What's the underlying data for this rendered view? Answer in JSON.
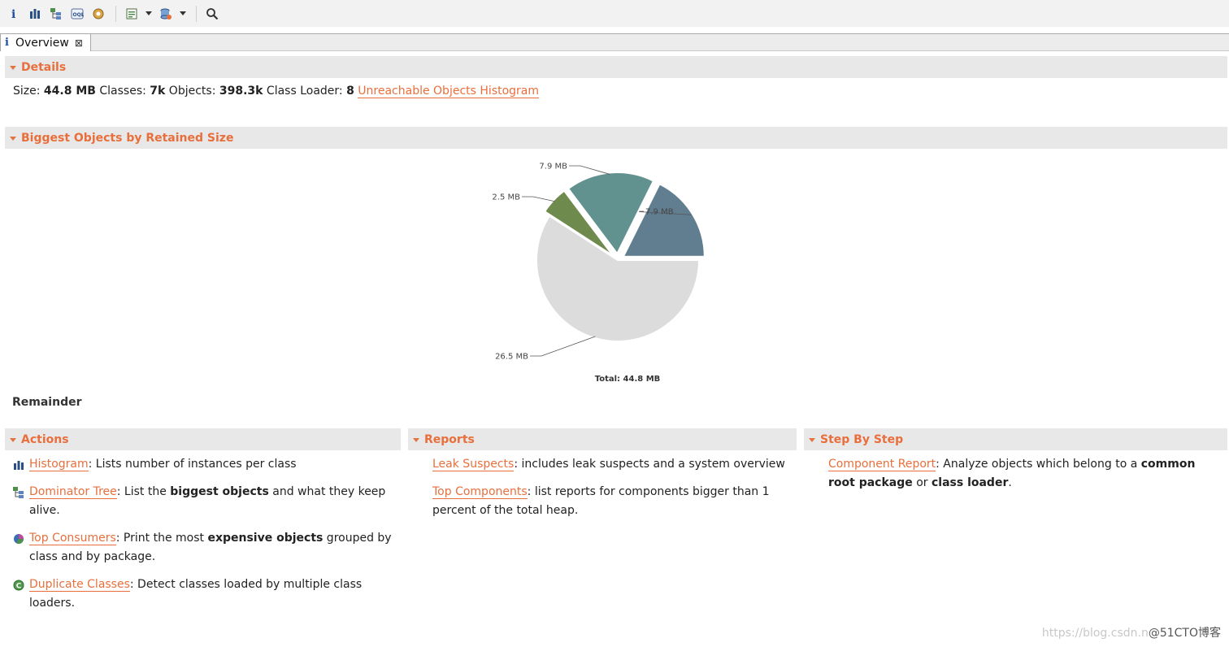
{
  "toolbar": {
    "buttons": [
      {
        "name": "info-icon"
      },
      {
        "name": "histogram-icon"
      },
      {
        "name": "dominator-tree-icon"
      },
      {
        "name": "oql-icon"
      },
      {
        "name": "heap-dump-overview-icon"
      },
      {
        "name": "query-browser-icon"
      },
      {
        "name": "find-object-icon"
      },
      {
        "name": "search-icon"
      }
    ]
  },
  "tab": {
    "label": "Overview",
    "close_glyph": "⊠"
  },
  "details": {
    "title": "Details",
    "size_label": "Size: ",
    "size_value": "44.8 MB",
    "classes_label": " Classes: ",
    "classes_value": "7k",
    "objects_label": " Objects: ",
    "objects_value": "398.3k",
    "loader_label": " Class Loader: ",
    "loader_value": "8",
    "link": "Unreachable Objects Histogram"
  },
  "biggest": {
    "title": "Biggest Objects by Retained Size",
    "remainder_label": "Remainder"
  },
  "chart_data": {
    "type": "pie",
    "total_label": "Total: 44.8 MB",
    "slices": [
      {
        "label": "7.9 MB",
        "value": 7.9,
        "color": "#617e91"
      },
      {
        "label": "7.9 MB",
        "value": 7.9,
        "color": "#61928f"
      },
      {
        "label": "2.5 MB",
        "value": 2.5,
        "color": "#6f8a4d"
      },
      {
        "label": "26.5 MB",
        "value": 26.5,
        "color": "#dcdcdc"
      }
    ]
  },
  "actions": {
    "title": "Actions",
    "items": [
      {
        "link": "Histogram",
        "pre": ": Lists number of instances per class",
        "bold": "",
        "post": ""
      },
      {
        "link": "Dominator Tree",
        "pre": ": List the ",
        "bold": "biggest objects",
        "post": " and what they keep alive."
      },
      {
        "link": "Top Consumers",
        "pre": ": Print the most ",
        "bold": "expensive objects",
        "post": " grouped by class and by package."
      },
      {
        "link": "Duplicate Classes",
        "pre": ": Detect classes loaded by multiple class loaders.",
        "bold": "",
        "post": ""
      }
    ]
  },
  "reports": {
    "title": "Reports",
    "items": [
      {
        "link": "Leak Suspects",
        "text": ": includes leak suspects and a system overview"
      },
      {
        "link": "Top Components",
        "text": ": list reports for components bigger than 1 percent of the total heap."
      }
    ]
  },
  "stepbystep": {
    "title": "Step By Step",
    "items": [
      {
        "link": "Component Report",
        "pre": ": Analyze objects which belong to a ",
        "bold1": "common root package",
        "mid": " or ",
        "bold2": "class loader",
        "post": "."
      }
    ]
  },
  "watermark": {
    "faint": "https://blog.csdn.n",
    "strong": "@51CTO博客"
  },
  "colors": {
    "accent": "#e86f3c",
    "header_bg": "#e8e8e8"
  }
}
